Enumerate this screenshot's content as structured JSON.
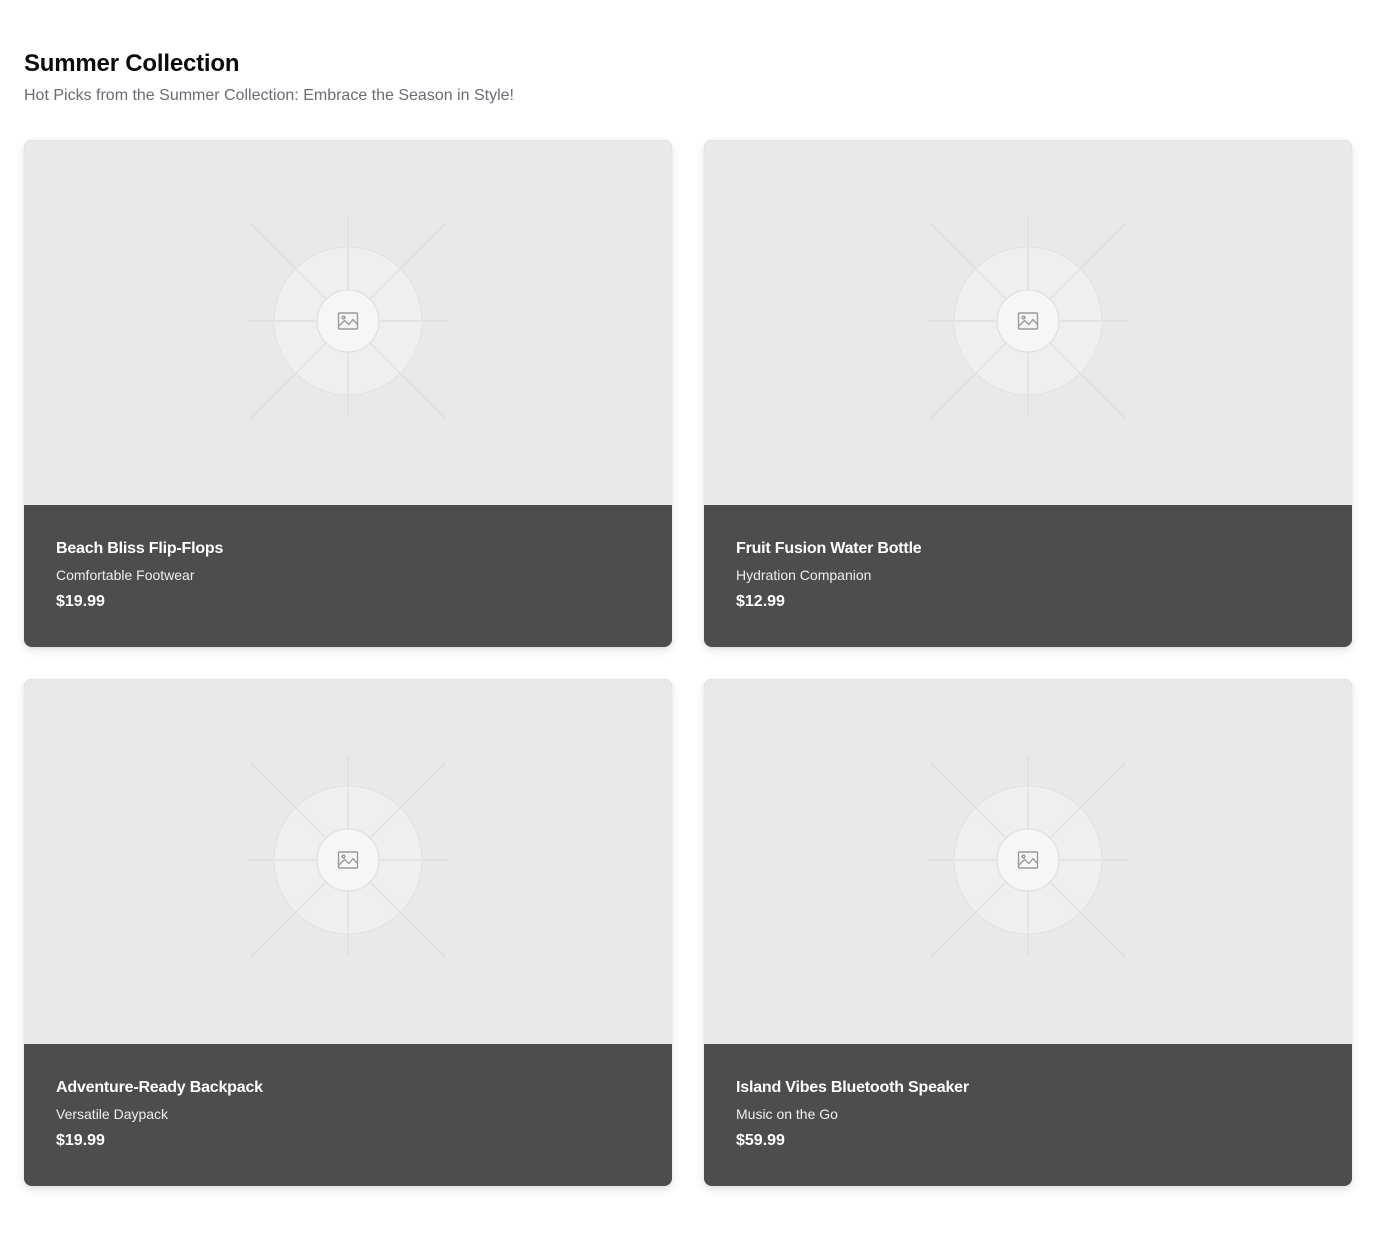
{
  "header": {
    "title": "Summer Collection",
    "subtitle": "Hot Picks from the Summer Collection: Embrace the Season in Style!"
  },
  "products": [
    {
      "name": "Beach Bliss Flip-Flops",
      "description": "Comfortable Footwear",
      "price": "$19.99",
      "image_icon": "image-placeholder-icon"
    },
    {
      "name": "Fruit Fusion Water Bottle",
      "description": "Hydration Companion",
      "price": "$12.99",
      "image_icon": "image-placeholder-icon"
    },
    {
      "name": "Adventure-Ready Backpack",
      "description": "Versatile Daypack",
      "price": "$19.99",
      "image_icon": "image-placeholder-icon"
    },
    {
      "name": "Island Vibes Bluetooth Speaker",
      "description": "Music on the Go",
      "price": "$59.99",
      "image_icon": "image-placeholder-icon"
    }
  ],
  "colors": {
    "card_info_background": "#4d4d4d",
    "image_placeholder_background": "#e9e9e9",
    "subtitle_text": "#6b6b73"
  }
}
